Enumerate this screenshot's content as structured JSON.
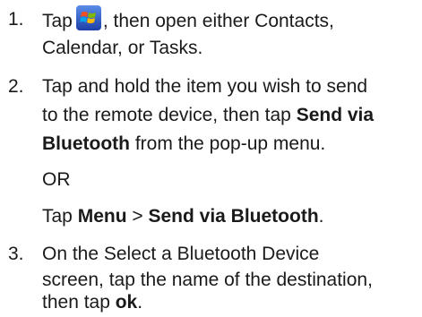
{
  "steps": [
    {
      "number": "1.",
      "tap": "Tap",
      "after_icon": ", then open either Contacts,",
      "line2": "Calendar, or Tasks.",
      "icon": "windows-start-icon"
    },
    {
      "number": "2.",
      "line1": "Tap and hold the item you wish to send",
      "line2_pre": "to the remote device, then tap ",
      "line2_bold": "Send via",
      "line3_bold": "Bluetooth",
      "line3_post": " from the pop-up menu.",
      "or": "OR",
      "alt_pre": "Tap ",
      "alt_bold1": "Menu",
      "alt_mid": " > ",
      "alt_bold2": "Send via Bluetooth",
      "alt_post": "."
    },
    {
      "number": "3.",
      "line1": "On the Select a Bluetooth Device",
      "line2": "screen, tap the name of the destination,",
      "line3_pre": "then tap ",
      "line3_bold": "ok",
      "line3_post": "."
    }
  ]
}
